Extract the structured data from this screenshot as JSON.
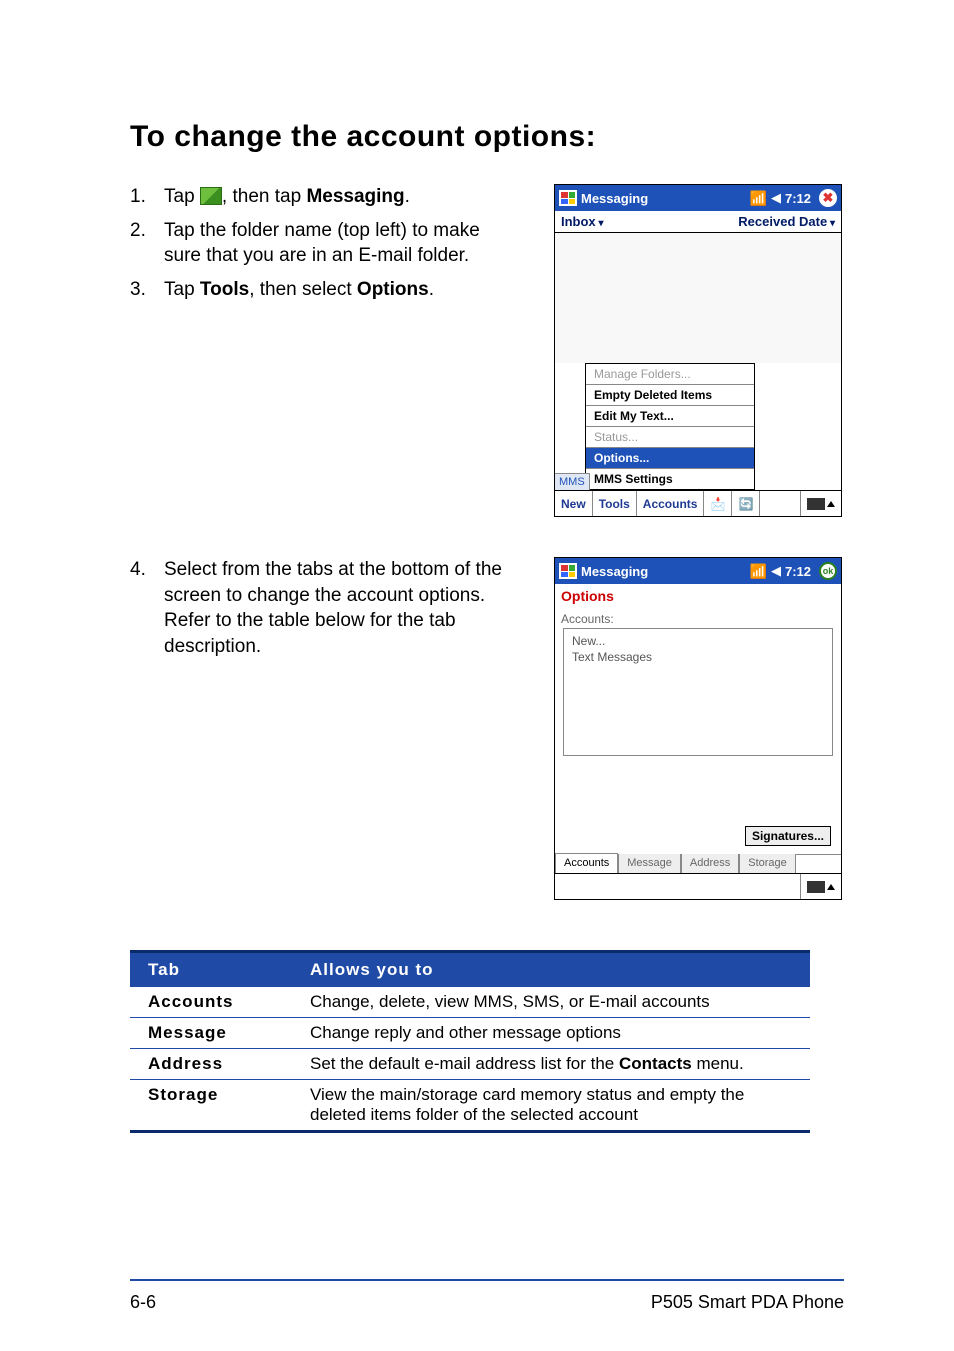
{
  "heading": "To change the account options:",
  "steps": [
    {
      "num": "1.",
      "pre": "Tap ",
      "icon": true,
      "mid": ", then tap ",
      "bold1": "Messaging",
      "post": "."
    },
    {
      "num": "2.",
      "text": "Tap the folder name (top left) to make sure that you are in an E-mail folder."
    },
    {
      "num": "3.",
      "pre": "Tap ",
      "bold1": "Tools",
      "mid": ", then select ",
      "bold2": "Options",
      "post": "."
    }
  ],
  "step4": {
    "num": "4.",
    "text": "Select from the tabs at the bottom of the screen to change the account options. Refer to the table below for the tab description."
  },
  "shot1": {
    "title": "Messaging",
    "time": "7:12",
    "close_glyph": "✖",
    "inbox_label": "Inbox",
    "received_label": "Received Date",
    "menu": {
      "manage": "Manage Folders...",
      "empty": "Empty Deleted Items",
      "edit": "Edit My Text...",
      "status": "Status...",
      "options": "Options...",
      "mms_settings": "MMS Settings"
    },
    "mms_tag": "MMS",
    "bottombar": {
      "new": "New",
      "tools": "Tools",
      "accounts": "Accounts"
    }
  },
  "shot2": {
    "title": "Messaging",
    "time": "7:12",
    "ok_glyph": "ok",
    "options_hdr": "Options",
    "accounts_lbl": "Accounts:",
    "account_items": {
      "new": "New...",
      "text": "Text Messages"
    },
    "signatures_btn": "Signatures...",
    "tabs": {
      "accounts": "Accounts",
      "message": "Message",
      "address": "Address",
      "storage": "Storage"
    }
  },
  "table": {
    "head": {
      "c1": "Tab",
      "c2": "Allows you to"
    },
    "rows": [
      {
        "c1": "Accounts",
        "c2": "Change, delete, view MMS, SMS, or E-mail accounts"
      },
      {
        "c1": "Message",
        "c2": "Change reply and other message options"
      },
      {
        "c1": "Address",
        "c2_pre": "Set the default e-mail address list for the ",
        "c2_bold": "Contacts",
        "c2_post": " menu."
      },
      {
        "c1": "Storage",
        "c2": "View the main/storage card memory status and empty the deleted items folder of the selected account"
      }
    ]
  },
  "footer": {
    "page": "6-6",
    "product": "P505 Smart PDA Phone"
  }
}
